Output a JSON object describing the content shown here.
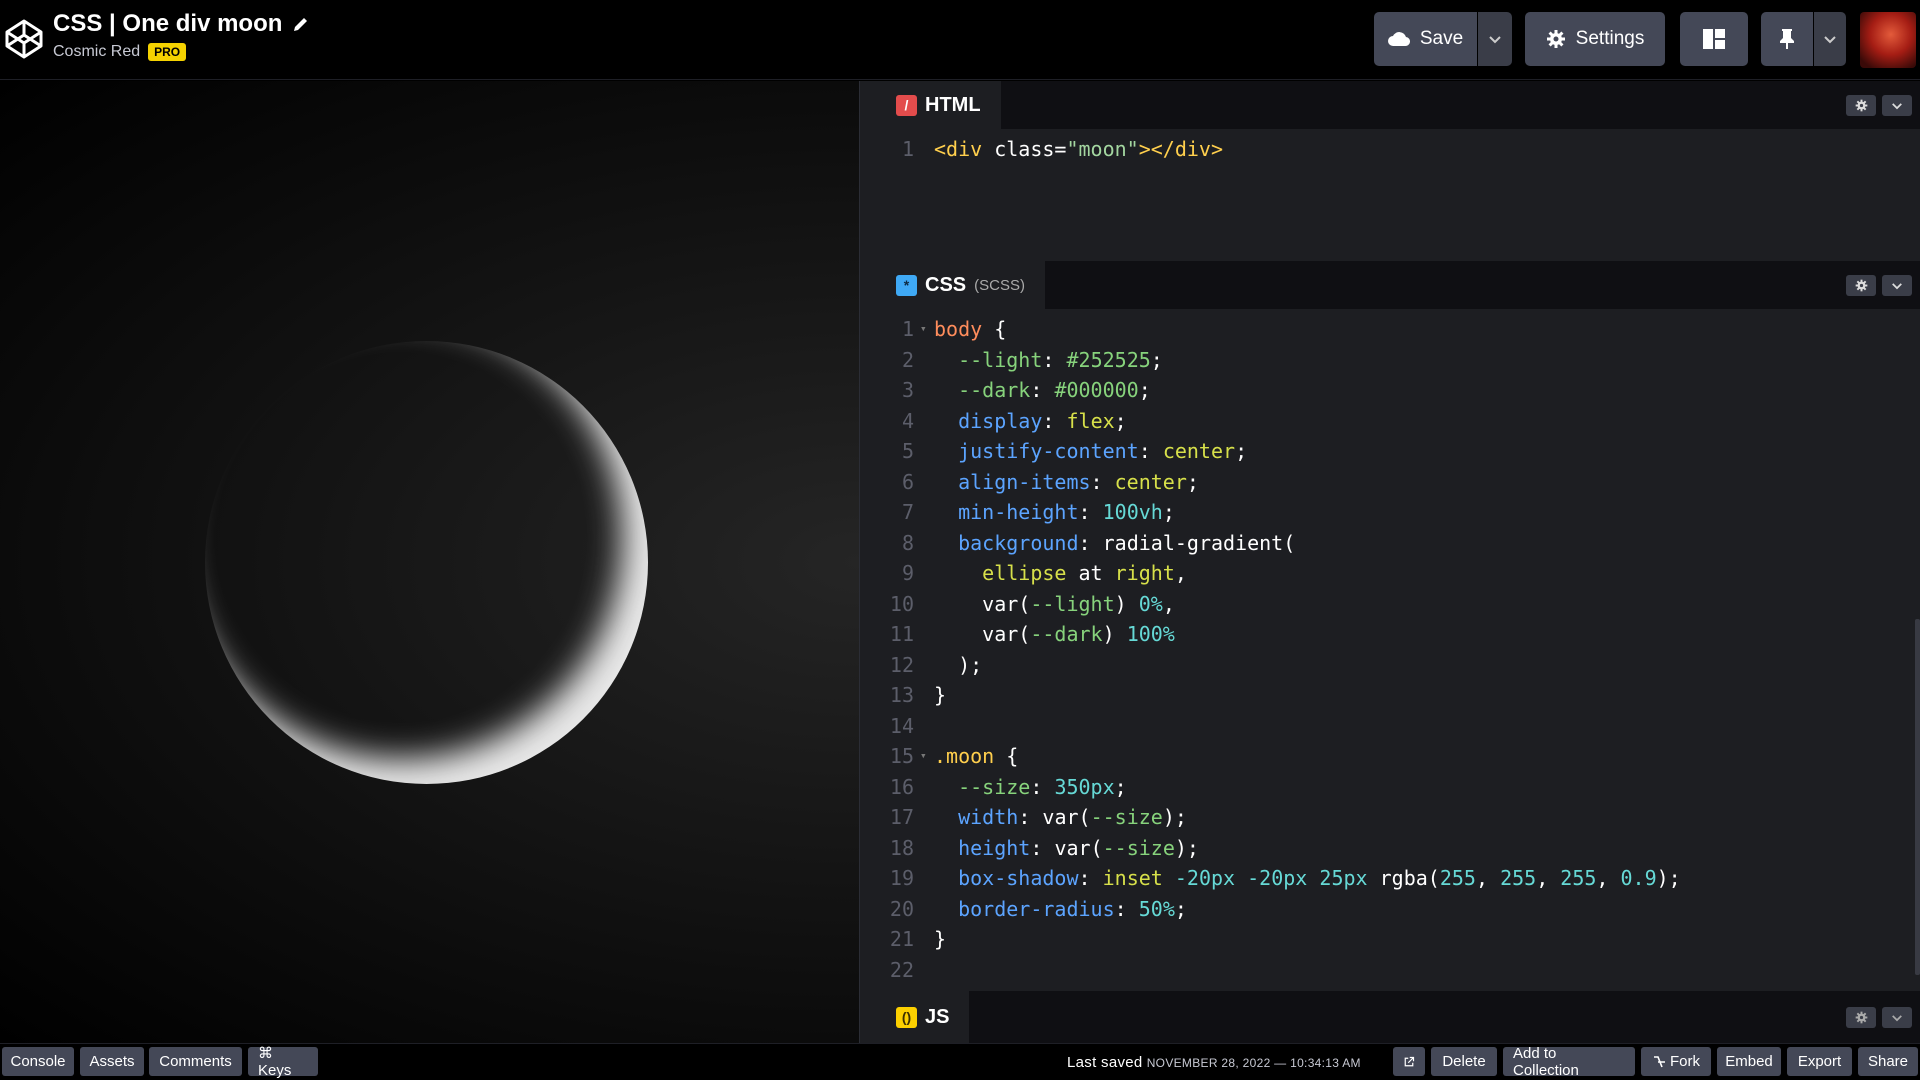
{
  "header": {
    "pen_title": "CSS | One div moon",
    "owner": "Cosmic Red",
    "pro_badge": "PRO",
    "save_label": "Save",
    "settings_label": "Settings"
  },
  "editors": {
    "html": {
      "tab_label": "HTML",
      "lines": [
        "<div class=\"moon\"></div>"
      ]
    },
    "css": {
      "tab_label": "CSS",
      "tab_sub": "(SCSS)"
    },
    "js": {
      "tab_label": "JS"
    }
  },
  "preview": {
    "css_light": "#252525",
    "css_dark": "#000000",
    "moon_size": "350px"
  },
  "footer": {
    "console": "Console",
    "assets": "Assets",
    "comments": "Comments",
    "keys": "⌘ Keys",
    "last_saved_label": "Last saved",
    "last_saved_time": "NOVEMBER 28, 2022 — 10:34:13 AM",
    "delete": "Delete",
    "add_to_collection": "Add to Collection",
    "fork": "Fork",
    "embed": "Embed",
    "export": "Export",
    "share": "Share"
  },
  "colors": {
    "accent_pro": "#f5d200",
    "button_bg": "#444857",
    "html_icon": "#e34c4c",
    "css_icon": "#3fa9f5",
    "js_icon": "#fcd000"
  }
}
